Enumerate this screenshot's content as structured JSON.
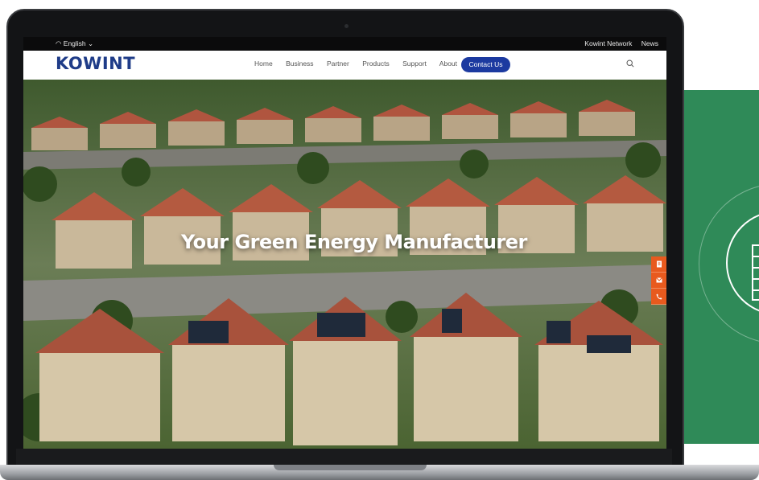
{
  "topbar": {
    "language": "English",
    "links": [
      "Kowint Network",
      "News"
    ]
  },
  "header": {
    "logo": "KOWINT",
    "menu": [
      "Home",
      "Business",
      "Partner",
      "Products",
      "Support",
      "About"
    ],
    "contact_label": "Contact Us"
  },
  "hero": {
    "title": "Your Green Energy Manufacturer"
  },
  "side_buttons": [
    "document-icon",
    "mail-icon",
    "phone-icon"
  ],
  "colors": {
    "brand": "#1f3c88",
    "contact_button": "#1c3aa0",
    "side_button": "#e85a1e",
    "panel_green": "#2f8a58"
  }
}
